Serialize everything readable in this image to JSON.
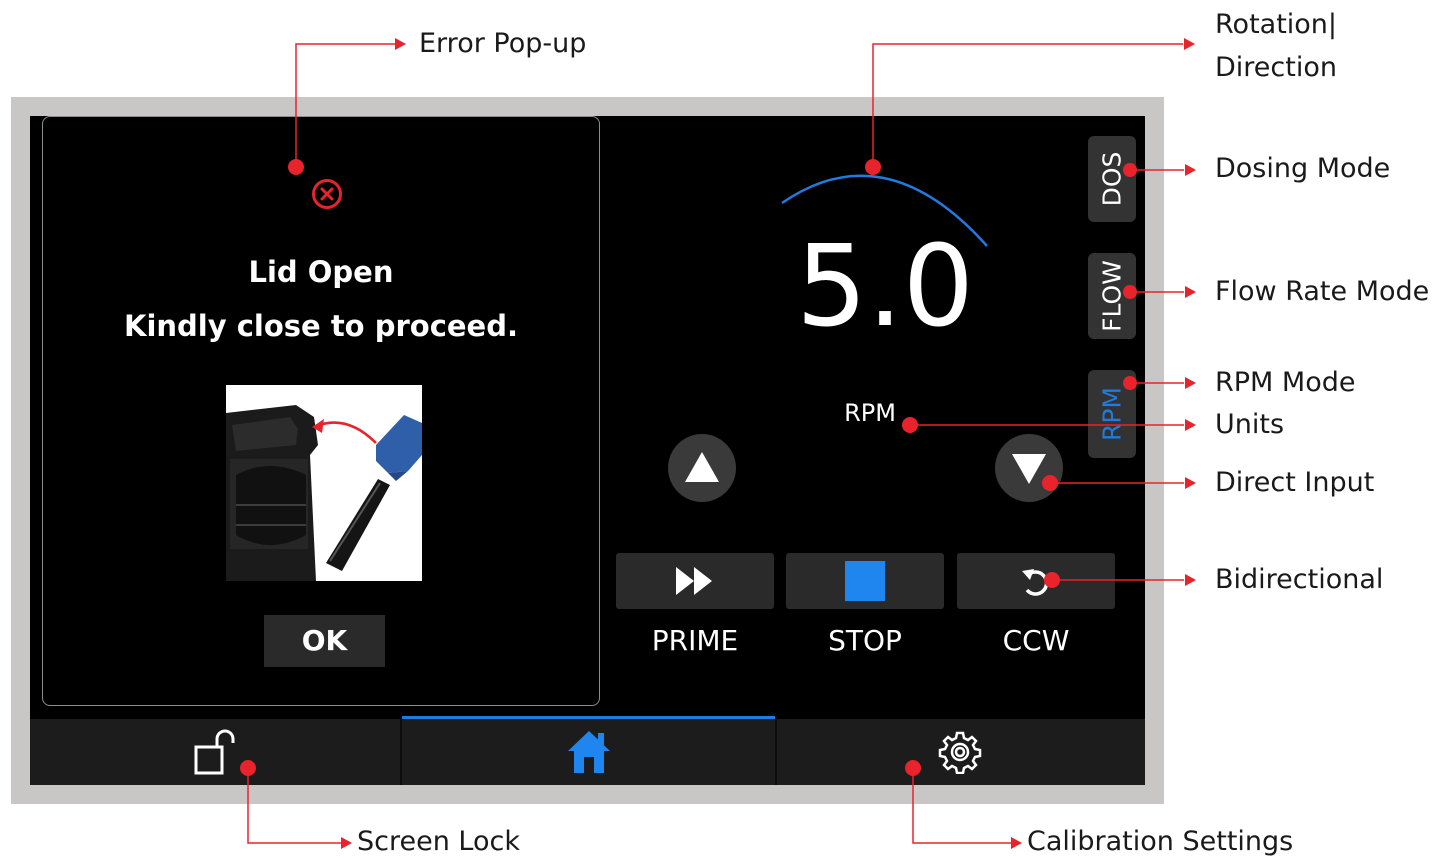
{
  "popup": {
    "title_line1": "Lid Open",
    "title_line2": "Kindly close to proceed.",
    "ok_label": "OK",
    "icon": "error-x-icon",
    "error_color": "#e8232b"
  },
  "display": {
    "value": "5.0",
    "units": "RPM",
    "arc_color": "#1f7be0"
  },
  "modes": [
    {
      "label": "DOS",
      "color": "#ffffff"
    },
    {
      "label": "FLOW",
      "color": "#ffffff"
    },
    {
      "label": "RPM",
      "color": "#1f7be0"
    }
  ],
  "actions": [
    {
      "label": "PRIME",
      "icon": "fast-forward-icon"
    },
    {
      "label": "STOP",
      "icon": "stop-square-icon"
    },
    {
      "label": "CCW",
      "icon": "counterclockwise-icon"
    }
  ],
  "nav": [
    {
      "icon": "unlock-icon"
    },
    {
      "icon": "home-icon"
    },
    {
      "icon": "gear-icon"
    }
  ],
  "annotations": {
    "error_popup": "Error Pop-up",
    "rotation_direction_line1": "Rotation|",
    "rotation_direction_line2": "Direction",
    "dosing_mode": "Dosing Mode",
    "flow_rate_mode": "Flow Rate Mode",
    "rpm_mode": "RPM Mode",
    "units": "Units",
    "direct_input": "Direct Input",
    "bidirectional": "Bidirectional",
    "screen_lock": "Screen Lock",
    "calibration_settings": "Calibration Settings",
    "color": "#e8232b"
  }
}
